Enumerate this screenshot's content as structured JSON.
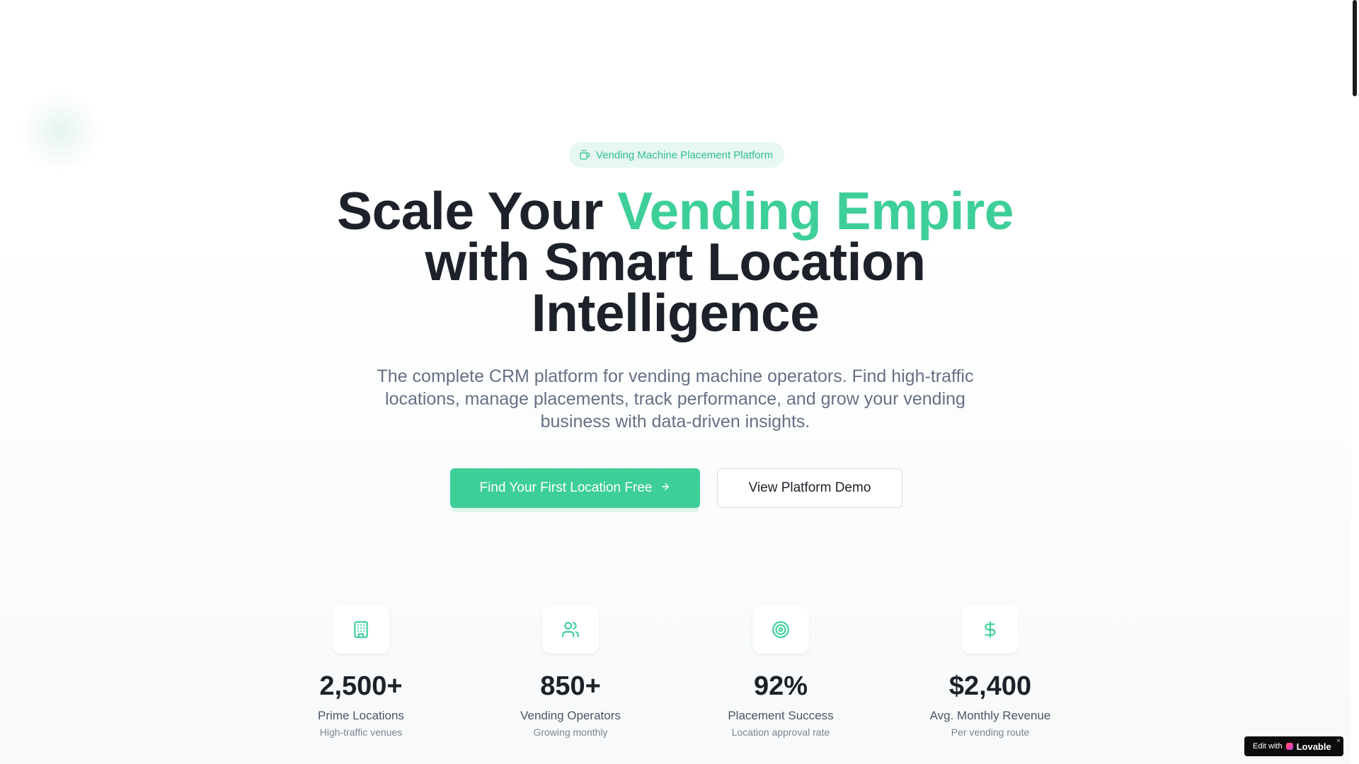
{
  "badge": {
    "icon": "coffee-cup-icon",
    "label": "Vending Machine Placement Platform"
  },
  "headline": {
    "part1": "Scale Your ",
    "accent": "Vending Empire",
    "line2": "with Smart Location",
    "line3": "Intelligence"
  },
  "subtitle": "The complete CRM platform for vending machine operators. Find high-traffic locations, manage placements, track performance, and grow your vending business with data-driven insights.",
  "cta": {
    "primary_label": "Find Your First Location Free",
    "secondary_label": "View Platform Demo"
  },
  "stats": [
    {
      "icon": "building-icon",
      "value": "2,500+",
      "label": "Prime Locations",
      "sub": "High-traffic venues"
    },
    {
      "icon": "users-icon",
      "value": "850+",
      "label": "Vending Operators",
      "sub": "Growing monthly"
    },
    {
      "icon": "target-icon",
      "value": "92%",
      "label": "Placement Success",
      "sub": "Location approval rate"
    },
    {
      "icon": "dollar-icon",
      "value": "$2,400",
      "label": "Avg. Monthly Revenue",
      "sub": "Per vending route"
    }
  ],
  "lovable_badge": {
    "prefix": "Edit with",
    "brand": "Lovable",
    "close": "×"
  },
  "colors": {
    "accent": "#3ecf99",
    "heading": "#1d2129",
    "muted": "#667085",
    "badge_bg": "#e7f7f1"
  }
}
